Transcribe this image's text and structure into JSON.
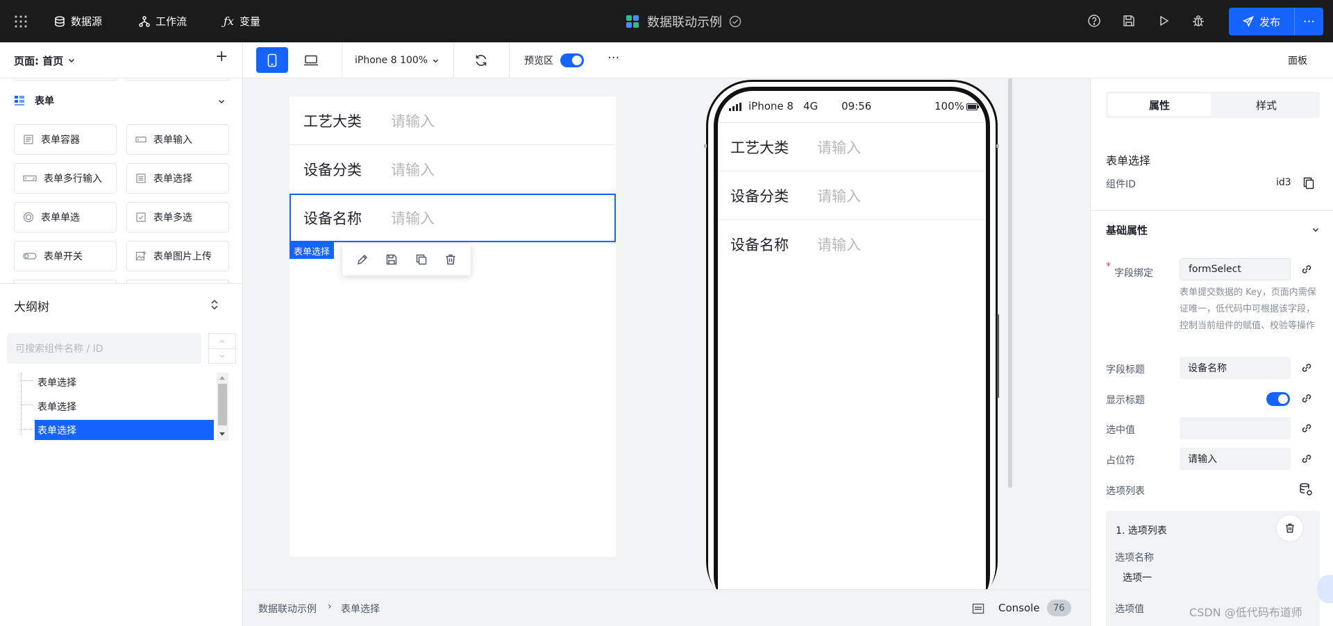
{
  "topbar": {
    "datasource": "数据源",
    "workflow": "工作流",
    "variable": "变量",
    "title": "数据联动示例",
    "publish": "发布",
    "more": "···"
  },
  "toolbar": {
    "page_label": "页面: 首页",
    "add": "+",
    "device": "iPhone 8 100%",
    "preview_label": "预览区",
    "more": "···",
    "panel": "面板"
  },
  "components": {
    "group_title": "表单",
    "items": [
      "表单容器",
      "表单输入",
      "表单多行输入",
      "表单选择",
      "表单单选",
      "表单多选",
      "表单开关",
      "表单图片上传"
    ]
  },
  "outline": {
    "title": "大纲树",
    "search_placeholder": "可搜索组件名称 / ID",
    "items": [
      "表单选择",
      "表单选择",
      "表单选择"
    ]
  },
  "canvas": {
    "rows": [
      {
        "label": "工艺大类",
        "placeholder": "请输入"
      },
      {
        "label": "设备分类",
        "placeholder": "请输入"
      },
      {
        "label": "设备名称",
        "placeholder": "请输入"
      }
    ],
    "selected_tag": "表单选择"
  },
  "phone": {
    "carrier": "iPhone 8",
    "network": "4G",
    "time": "09:56",
    "battery": "100%",
    "rows": [
      {
        "label": "工艺大类",
        "placeholder": "请输入"
      },
      {
        "label": "设备分类",
        "placeholder": "请输入"
      },
      {
        "label": "设备名称",
        "placeholder": "请输入"
      }
    ]
  },
  "status": {
    "breadcrumb_root": "数据联动示例",
    "breadcrumb_sep": "›",
    "breadcrumb_leaf": "表单选择",
    "console": "Console",
    "console_count": "76"
  },
  "props": {
    "tab_props": "属性",
    "tab_style": "样式",
    "component_name": "表单选择",
    "component_id_label": "组件ID",
    "component_id": "id3",
    "section_basic": "基础属性",
    "field_binding_label": "字段绑定",
    "field_binding_value": "formSelect",
    "field_binding_help": "表单提交数据的 Key，页面内需保证唯一，低代码中可根据该字段，控制当前组件的赋值、校验等操作",
    "field_title_label": "字段标题",
    "field_title_value": "设备名称",
    "show_title_label": "显示标题",
    "selected_value_label": "选中值",
    "placeholder_label": "占位符",
    "placeholder_value": "请输入",
    "option_list_label": "选项列表",
    "option_card_title": "1. 选项列表",
    "option_name_label": "选项名称",
    "option_name_value": "选项一",
    "option_value_label": "选项值"
  },
  "watermark": "CSDN @低代码布道师",
  "colors": {
    "accent": "#1664ff",
    "topbar": "#1b1b1b"
  }
}
